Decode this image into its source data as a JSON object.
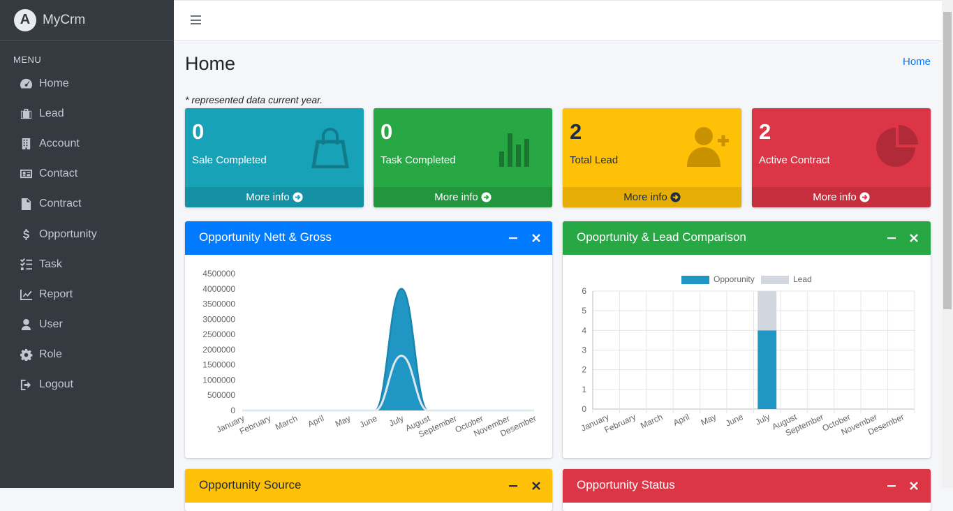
{
  "brand": {
    "name": "MyCrm",
    "logo_letter": "A"
  },
  "menu_header": "MENU",
  "nav": [
    {
      "label": "Home",
      "icon": "tachometer-icon"
    },
    {
      "label": "Lead",
      "icon": "briefcase-icon"
    },
    {
      "label": "Account",
      "icon": "building-icon"
    },
    {
      "label": "Contact",
      "icon": "address-card-icon"
    },
    {
      "label": "Contract",
      "icon": "file-contract-icon"
    },
    {
      "label": "Opportunity",
      "icon": "dollar-icon"
    },
    {
      "label": "Task",
      "icon": "tasks-icon"
    },
    {
      "label": "Report",
      "icon": "chart-line-icon"
    },
    {
      "label": "User",
      "icon": "user-icon"
    },
    {
      "label": "Role",
      "icon": "gear-icon"
    },
    {
      "label": "Logout",
      "icon": "sign-out-icon"
    }
  ],
  "page": {
    "title": "Home",
    "breadcrumb": "Home",
    "note": "* represented data current year."
  },
  "boxes": [
    {
      "value": "0",
      "label": "Sale Completed",
      "footer": "More info",
      "color": "#17a2b8",
      "icon": "shopping-bag-icon"
    },
    {
      "value": "0",
      "label": "Task Completed",
      "footer": "More info",
      "color": "#28a745",
      "icon": "bar-chart-icon"
    },
    {
      "value": "2",
      "label": "Total Lead",
      "footer": "More info",
      "color": "#ffc107",
      "icon": "user-plus-icon"
    },
    {
      "value": "2",
      "label": "Active Contract",
      "footer": "More info",
      "color": "#dc3545",
      "icon": "pie-chart-icon"
    }
  ],
  "cards": {
    "nett_gross": {
      "title": "Opportunity Nett & Gross",
      "color": "#007bff"
    },
    "comparison": {
      "title": "Opoprtunity & Lead Comparison",
      "color": "#28a745"
    },
    "source": {
      "title": "Opportunity Source",
      "color": "#ffc107"
    },
    "status": {
      "title": "Opportunity Status",
      "color": "#dc3545"
    }
  },
  "chart_data": [
    {
      "type": "area",
      "categories": [
        "January",
        "February",
        "March",
        "April",
        "May",
        "June",
        "July",
        "August",
        "September",
        "October",
        "November",
        "Desember"
      ],
      "series": [
        {
          "values": [
            0,
            0,
            0,
            0,
            0,
            0,
            4000000,
            0,
            0,
            0,
            0,
            0
          ],
          "color": "#1f96c4"
        },
        {
          "values": [
            0,
            0,
            0,
            0,
            0,
            0,
            1800000,
            0,
            0,
            0,
            0,
            0
          ],
          "color": "#dfe8ee"
        }
      ],
      "ylim": [
        0,
        4500000
      ],
      "yticks": [
        0,
        500000,
        1000000,
        1500000,
        2000000,
        2500000,
        3000000,
        3500000,
        4000000,
        4500000
      ],
      "grid": false
    },
    {
      "type": "bar",
      "stacked": true,
      "categories": [
        "January",
        "February",
        "March",
        "April",
        "May",
        "June",
        "July",
        "August",
        "September",
        "October",
        "November",
        "Desember"
      ],
      "series": [
        {
          "name": "Opporunity",
          "values": [
            0,
            0,
            0,
            0,
            0,
            0,
            4,
            0,
            0,
            0,
            0,
            0
          ],
          "color": "#1f96c4"
        },
        {
          "name": "Lead",
          "values": [
            0,
            0,
            0,
            0,
            0,
            0,
            2,
            0,
            0,
            0,
            0,
            0
          ],
          "color": "#d2d6de"
        }
      ],
      "ylim": [
        0,
        6
      ],
      "yticks": [
        0,
        1,
        2,
        3,
        4,
        5,
        6
      ],
      "grid": true,
      "legend": "top"
    }
  ]
}
